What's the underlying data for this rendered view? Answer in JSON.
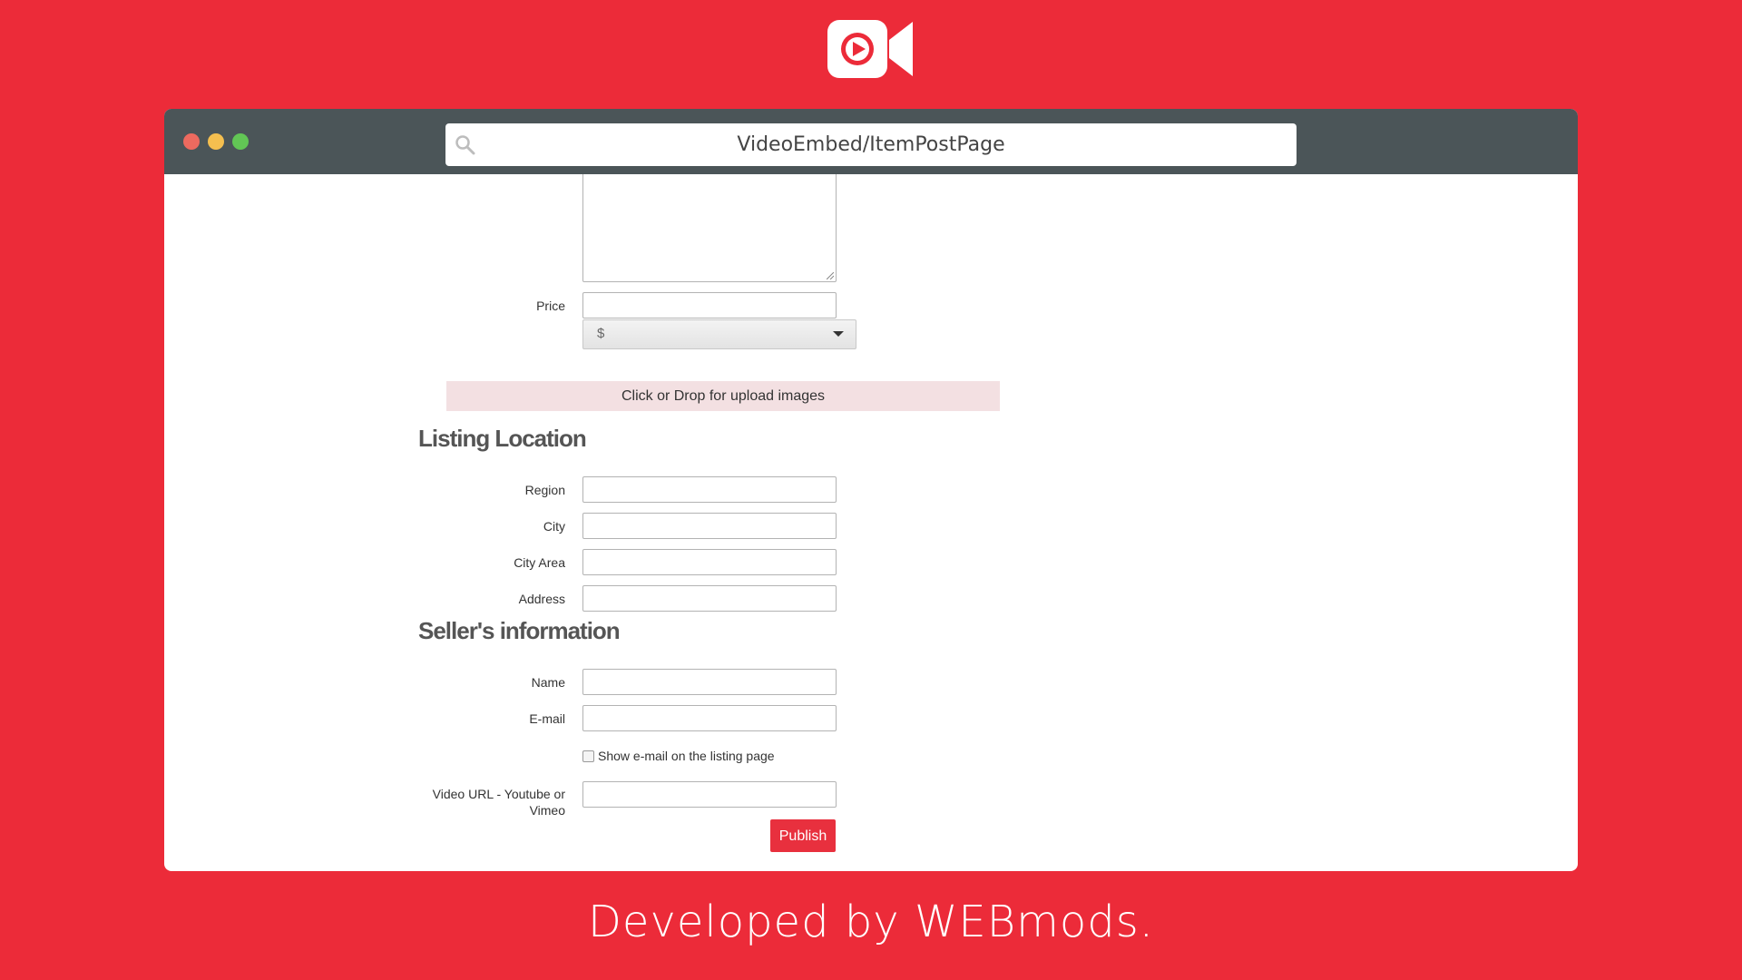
{
  "colors": {
    "background": "#ec2b39",
    "titlebar": "#4b5558",
    "publish": "#e8303e",
    "upload_zone": "#f3e0e2"
  },
  "logo": {
    "icon": "video-camera-play-icon"
  },
  "browser": {
    "url": "VideoEmbed/ItemPostPage"
  },
  "form": {
    "price_label": "Price",
    "currency_value": "$",
    "upload_text": "Click or Drop for upload images",
    "location_heading": "Listing Location",
    "region_label": "Region",
    "city_label": "City",
    "city_area_label": "City Area",
    "address_label": "Address",
    "seller_heading": "Seller's information",
    "name_label": "Name",
    "email_label": "E-mail",
    "show_email_label": "Show e-mail on the listing page",
    "video_label_line1": "Video URL - Youtube or",
    "video_label_line2": "Vimeo",
    "publish_label": "Publish"
  },
  "footer": {
    "text": "Developed by WEBmods."
  }
}
